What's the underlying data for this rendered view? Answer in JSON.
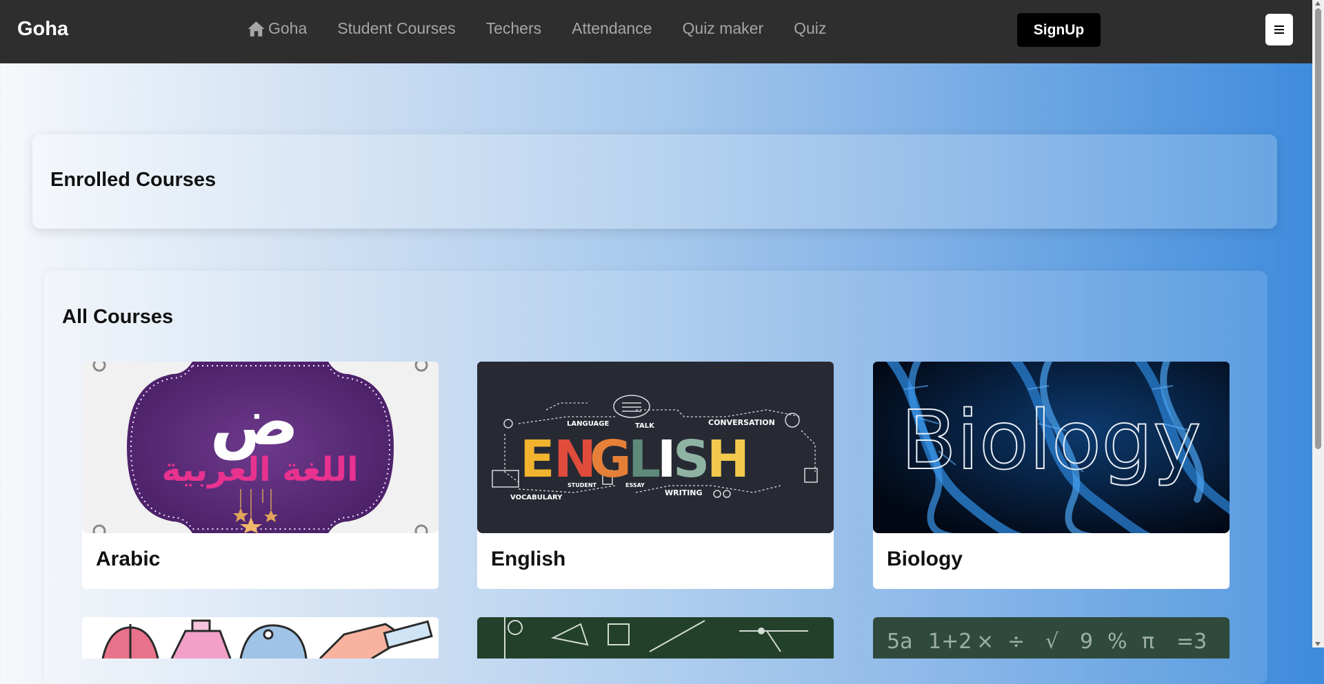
{
  "navbar": {
    "brand": "Goha",
    "links": [
      {
        "label": "Goha",
        "icon": "home-icon"
      },
      {
        "label": "Student Courses"
      },
      {
        "label": "Techers"
      },
      {
        "label": "Attendance"
      },
      {
        "label": "Quiz maker"
      },
      {
        "label": "Quiz"
      }
    ],
    "signup_label": "SignUp",
    "toggler_icon": "hamburger-icon"
  },
  "enrolled": {
    "title": "Enrolled Courses"
  },
  "all_courses": {
    "title": "All Courses",
    "courses": [
      {
        "title": "Arabic",
        "image_text": "اللغة العربية",
        "image_letter": "ض"
      },
      {
        "title": "English",
        "image_text": "ENGLISH",
        "image_words": [
          "LANGUAGE",
          "TALK",
          "CONVERSATION",
          "VOCABULARY",
          "STUDENT",
          "ESSAY",
          "WRITING"
        ]
      },
      {
        "title": "Biology",
        "image_text": "Biology"
      }
    ]
  },
  "colors": {
    "navbar_bg": "#2e2e2e",
    "nav_link": "#a6a6a6",
    "signup_bg": "#000000",
    "page_gradient_end": "#3d8bdc"
  }
}
